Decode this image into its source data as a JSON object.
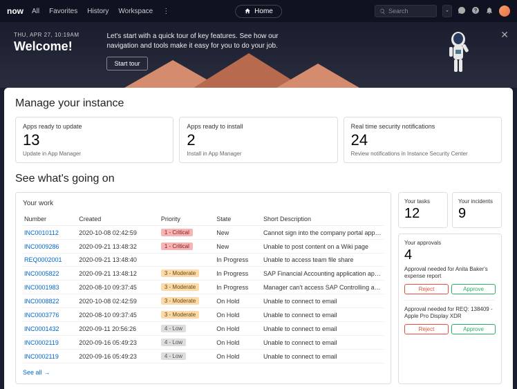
{
  "topbar": {
    "logo": "now",
    "nav": [
      "All",
      "Favorites",
      "History",
      "Workspace"
    ],
    "home": "Home",
    "search_placeholder": "Search"
  },
  "hero": {
    "date": "THU, APR 27, 10:19AM",
    "title": "Welcome!",
    "text": "Let's start with a quick tour of key features. See how our navigation and tools make it easy for you to do your job.",
    "button": "Start tour"
  },
  "manage": {
    "title": "Manage your instance",
    "cards": [
      {
        "label": "Apps ready to update",
        "num": "13",
        "sub": "Update in App Manager"
      },
      {
        "label": "Apps ready to install",
        "num": "2",
        "sub": "Install in App Manager"
      },
      {
        "label": "Real time security notifications",
        "num": "24",
        "sub": "Review notifications in Instance Security Center"
      }
    ]
  },
  "going": {
    "title": "See what's going on",
    "work_title": "Your work",
    "headers": [
      "Number",
      "Created",
      "Priority",
      "State",
      "Short Description"
    ],
    "rows": [
      {
        "num": "INC0010112",
        "created": "2020-10-08 02:42:59",
        "pri": "1 - Critical",
        "pri_class": "critical",
        "state": "New",
        "desc": "Cannot sign into the company portal application..."
      },
      {
        "num": "INC0009286",
        "created": "2020-09-21 13:48:32",
        "pri": "1 - Critical",
        "pri_class": "critical",
        "state": "New",
        "desc": "Unable to post content on a Wiki page"
      },
      {
        "num": "REQ0002001",
        "created": "2020-09-21 13:48:40",
        "pri": "",
        "pri_class": "",
        "state": "In Progress",
        "desc": "Unable to access team file share"
      },
      {
        "num": "INC0005822",
        "created": "2020-09-21 13:48:12",
        "pri": "3 - Moderate",
        "pri_class": "moderate",
        "state": "In Progress",
        "desc": "SAP Financial Accounting application appears to..."
      },
      {
        "num": "INC0001983",
        "created": "2020-08-10 09:37:45",
        "pri": "3 - Moderate",
        "pri_class": "moderate",
        "state": "In Progress",
        "desc": "Manager can't access SAP Controlling applicatio..."
      },
      {
        "num": "INC0008822",
        "created": "2020-10-08 02:42:59",
        "pri": "3 - Moderate",
        "pri_class": "moderate",
        "state": "On Hold",
        "desc": "Unable to connect to email"
      },
      {
        "num": "INC0003776",
        "created": "2020-08-10 09:37:45",
        "pri": "3 - Moderate",
        "pri_class": "moderate",
        "state": "On Hold",
        "desc": "Unable to connect to email"
      },
      {
        "num": "INC0001432",
        "created": "2020-09-11 20:56:26",
        "pri": "4 - Low",
        "pri_class": "low",
        "state": "On Hold",
        "desc": "Unable to connect to email"
      },
      {
        "num": "INC0002119",
        "created": "2020-09-16 05:49:23",
        "pri": "4 - Low",
        "pri_class": "low",
        "state": "On Hold",
        "desc": "Unable to connect to email"
      },
      {
        "num": "INC0002119",
        "created": "2020-09-16 05:49:23",
        "pri": "4 - Low",
        "pri_class": "low",
        "state": "On Hold",
        "desc": "Unable to connect to email"
      }
    ],
    "see_all": "See all"
  },
  "side": {
    "tasks": {
      "label": "Your tasks",
      "num": "12"
    },
    "incidents": {
      "label": "Your incidents",
      "num": "9"
    },
    "approvals": {
      "title": "Your approvals",
      "num": "4",
      "items": [
        {
          "text": "Approval needed for Anita Baker's expense report"
        },
        {
          "text": "Approval needed for REQ: 138409 - Apple Pro Display XDR"
        }
      ],
      "reject": "Reject",
      "approve": "Approve"
    }
  }
}
